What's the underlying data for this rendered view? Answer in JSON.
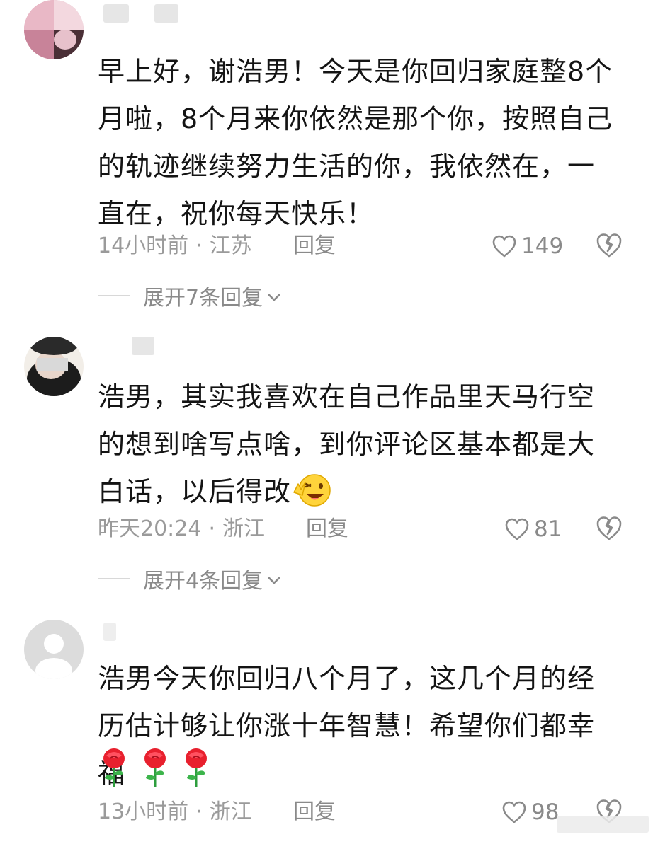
{
  "comments": [
    {
      "text": "早上好，谢浩男！今天是你回归家庭整8个月啦，8个月来你依然是那个你，按照自己的轨迹继续努力生活的你，我依然在，一直在，祝你每天快乐！",
      "time": "14小时前",
      "location": "江苏",
      "reply_label": "回复",
      "likes": "149",
      "expand_label": "展开7条回复"
    },
    {
      "text": "浩男，其实我喜欢在自己作品里天马行空的想到啥写点啥，到你评论区基本都是大白话，以后得改",
      "time": "昨天20:24",
      "location": "浙江",
      "reply_label": "回复",
      "likes": "81",
      "expand_label": "展开4条回复"
    },
    {
      "text": "浩男今天你回归八个月了，这几个月的经历估计够让你涨十年智慧！希望你们都幸福",
      "time": "13小时前",
      "location": "浙江",
      "reply_label": "回复",
      "likes": "98"
    }
  ],
  "meta_separator": "·",
  "icons": {
    "like": "heart-outline-icon",
    "dislike": "broken-heart-icon",
    "expand": "chevron-down-icon",
    "emoji_wink": "winking-face-emoji",
    "emoji_rose": "rose-emoji"
  },
  "colors": {
    "text": "#141414",
    "meta": "#9a9a9a",
    "icon": "#8a8a8a",
    "background": "#ffffff"
  }
}
